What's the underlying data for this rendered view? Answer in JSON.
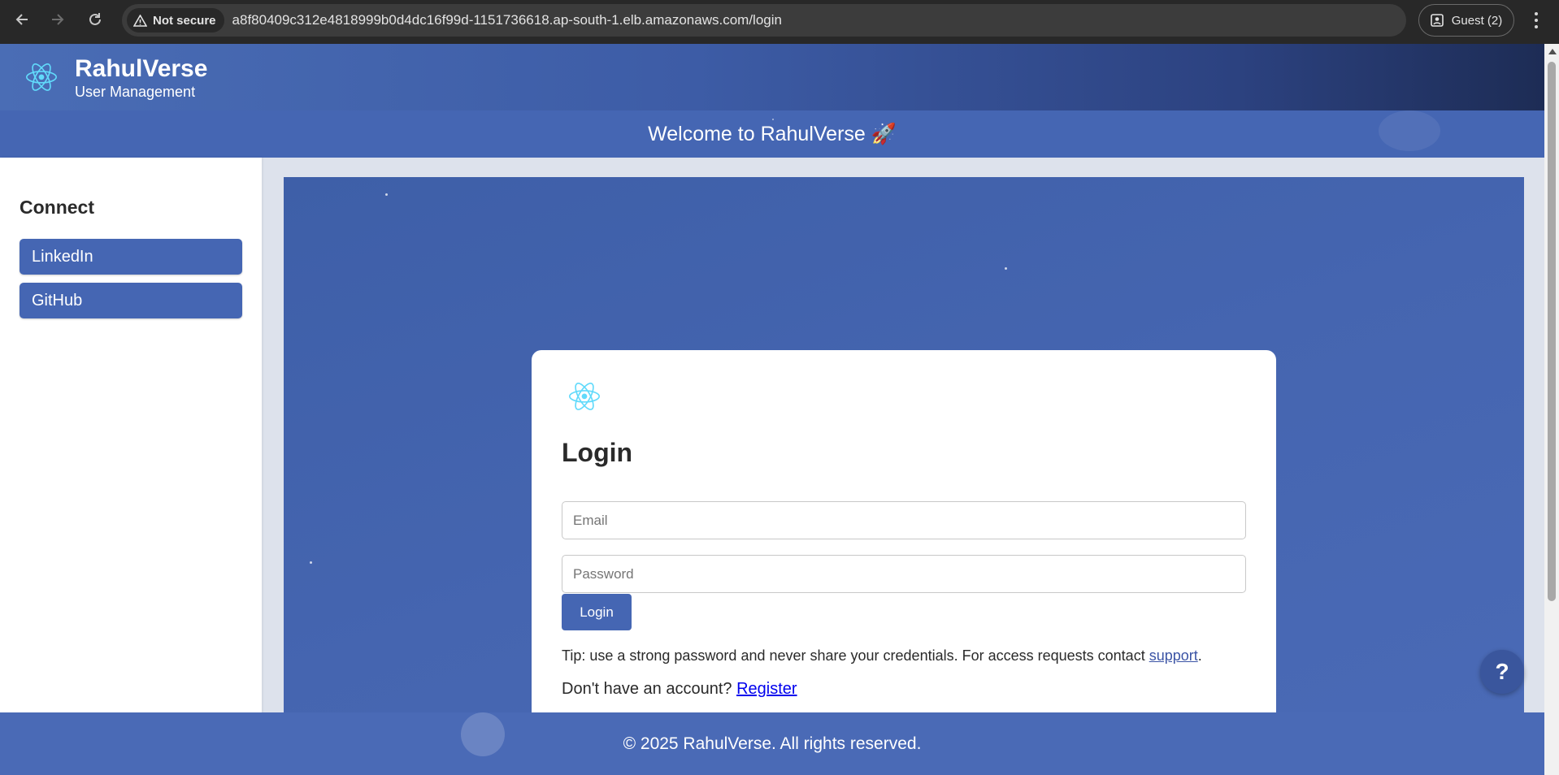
{
  "browser": {
    "security_label": "Not secure",
    "url": "a8f80409c312e4818999b0d4dc16f99d-1151736618.ap-south-1.elb.amazonaws.com/login",
    "profile_label": "Guest (2)"
  },
  "header": {
    "brand_title": "RahulVerse",
    "brand_subtitle": "User Management",
    "welcome_text": "Welcome to RahulVerse 🚀"
  },
  "sidebar": {
    "title": "Connect",
    "items": [
      {
        "label": "LinkedIn"
      },
      {
        "label": "GitHub"
      }
    ]
  },
  "login": {
    "title": "Login",
    "email_placeholder": "Email",
    "password_placeholder": "Password",
    "submit_label": "Login",
    "tip_text": "Tip: use a strong password and never share your credentials. For access requests contact ",
    "tip_link": "support",
    "tip_end": ".",
    "signup_text": "Don't have an account? ",
    "signup_link": "Register"
  },
  "help": {
    "label": "?"
  },
  "footer": {
    "text": "© 2025 RahulVerse. All rights reserved."
  },
  "colors": {
    "primary": "#4566b3",
    "header_dark": "#1d2c55",
    "react_logo": "#61dafb"
  }
}
